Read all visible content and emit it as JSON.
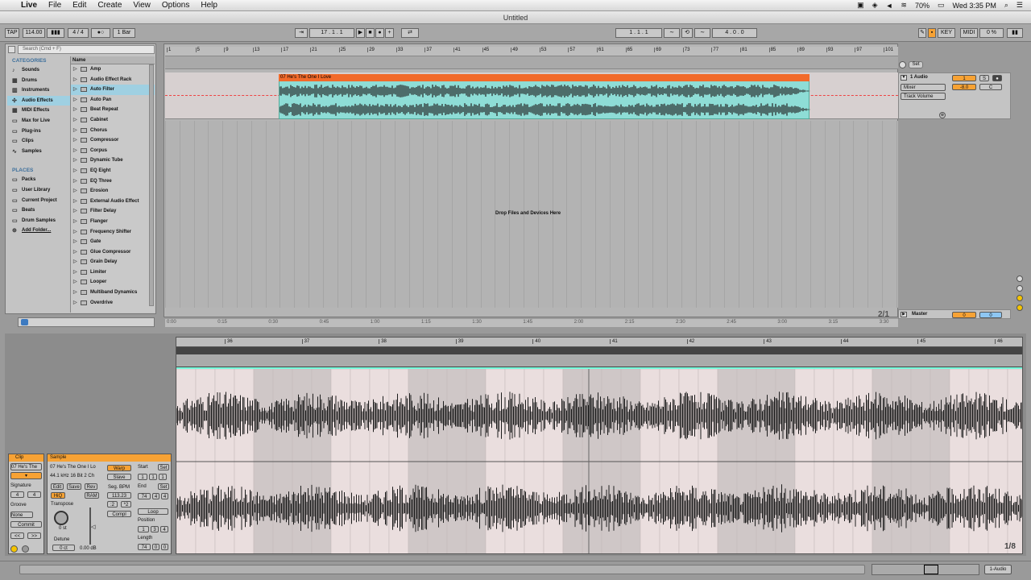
{
  "menubar": {
    "app": "Live",
    "items": [
      "File",
      "Edit",
      "Create",
      "View",
      "Options",
      "Help"
    ],
    "battery": "70%",
    "clock": "Wed 3:35 PM"
  },
  "window": {
    "title": "Untitled"
  },
  "transport": {
    "tap": "TAP",
    "tempo": "114.00",
    "time_sig": "4 / 4",
    "quantize": "1 Bar",
    "position": "17 . 1 . 1",
    "loop_start": "1 . 1 . 1",
    "loop_length": "4 . 0 . 0",
    "key": "KEY",
    "midi": "MIDI",
    "cpu": "0 %"
  },
  "browser": {
    "search_placeholder": "Search (Cmd + F)",
    "categories_title": "CATEGORIES",
    "categories": [
      "Sounds",
      "Drums",
      "Instruments",
      "Audio Effects",
      "MIDI Effects",
      "Max for Live",
      "Plug-ins",
      "Clips",
      "Samples"
    ],
    "places_title": "PLACES",
    "places": [
      "Packs",
      "User Library",
      "Current Project",
      "Beats",
      "Drum Samples",
      "Add Folder..."
    ],
    "name_header": "Name",
    "items": [
      "Amp",
      "Audio Effect Rack",
      "Auto Filter",
      "Auto Pan",
      "Beat Repeat",
      "Cabinet",
      "Chorus",
      "Compressor",
      "Corpus",
      "Dynamic Tube",
      "EQ Eight",
      "EQ Three",
      "Erosion",
      "External Audio Effect",
      "Filter Delay",
      "Flanger",
      "Frequency Shifter",
      "Gate",
      "Glue Compressor",
      "Grain Delay",
      "Limiter",
      "Looper",
      "Multiband Dynamics",
      "Overdrive"
    ]
  },
  "arrangement": {
    "ruler_bars": [
      "1",
      "5",
      "9",
      "13",
      "17",
      "21",
      "25",
      "29",
      "33",
      "37",
      "41",
      "45",
      "49",
      "53",
      "57",
      "61",
      "65",
      "69",
      "73",
      "77",
      "81",
      "85",
      "89",
      "93",
      "97",
      "101"
    ],
    "time_labels": [
      "0:00",
      "0:15",
      "0:30",
      "0:45",
      "1:00",
      "1:15",
      "1:30",
      "1:45",
      "2:00",
      "2:15",
      "2:30",
      "2:45",
      "3:00",
      "3:15",
      "3:30"
    ],
    "clip_name": "07 He's The One I Love",
    "drop_hint": "Drop Files and Devices Here",
    "zoom": "2/1",
    "track": {
      "name": "1 Audio",
      "mixer": "Mixer",
      "automation": "Track Volume",
      "number": "1",
      "level": "-8.0",
      "pan": "C",
      "solo": "S"
    },
    "master": {
      "name": "Master",
      "volume": "0",
      "pan": "0"
    },
    "set_label": "Set"
  },
  "detail": {
    "ruler_bars": [
      "36",
      "37",
      "38",
      "39",
      "40",
      "41",
      "42",
      "43",
      "44",
      "45",
      "46"
    ],
    "zoom": "1/8",
    "clip": {
      "header": "Clip",
      "name": "07 He's The",
      "signature_label": "Signature",
      "sig_num": "4",
      "sig_den": "4",
      "groove_label": "Groove",
      "groove": "None",
      "commit": "Commit"
    },
    "sample": {
      "header": "Sample",
      "name": "07 He's The One I Lo",
      "info": "44.1 kHz 16 Bit 2 Ch",
      "edit": "Edit",
      "save": "Save",
      "rev": "Rev",
      "hiq": "HiQ",
      "ram": "RAM",
      "transpose_label": "Transpose",
      "transpose": "0 st",
      "detune_label": "Detune",
      "detune": "0 ct",
      "gain": "0.00 dB",
      "warp": "Warp",
      "slave": "Slave",
      "seg_bpm_label": "Seg. BPM",
      "seg_bpm": "113.23",
      "x2": ":2",
      "x2b": "*2",
      "mode": "Compl",
      "start_label": "Start",
      "set": "Set",
      "start": [
        "1",
        "1",
        "1"
      ],
      "end_label": "End",
      "end": [
        "74",
        "4",
        "4"
      ],
      "loop": "Loop",
      "position_label": "Position",
      "position": [
        "1",
        "3",
        "4"
      ],
      "length_label": "Length",
      "length": [
        "74",
        "0",
        "0"
      ]
    }
  },
  "status": {
    "track": "1-Audio"
  }
}
